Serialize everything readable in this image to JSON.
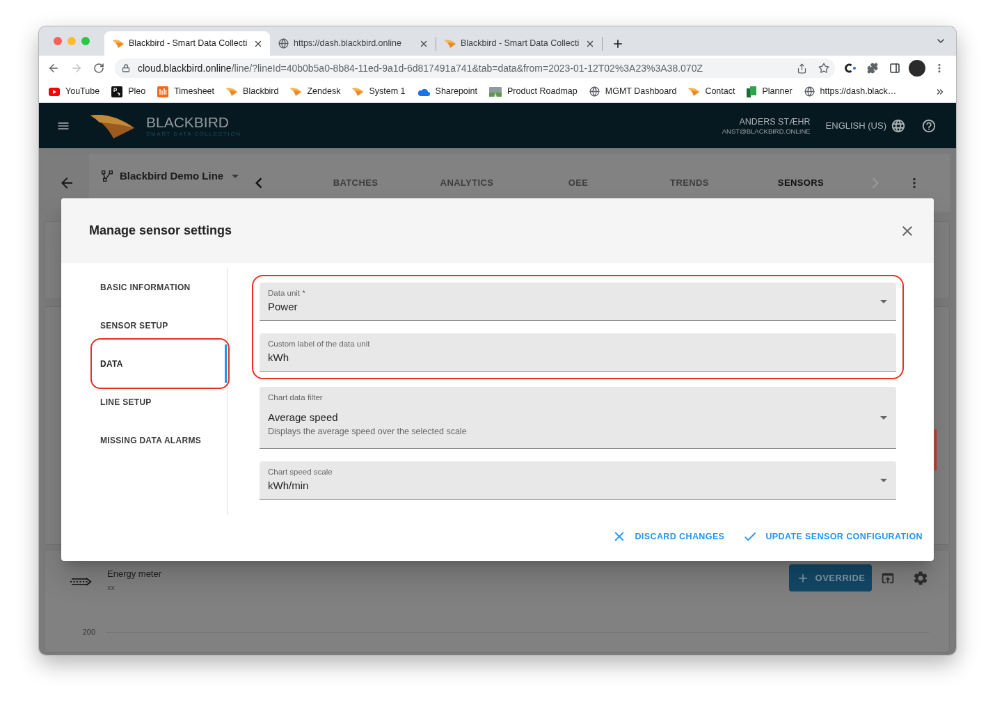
{
  "browser": {
    "tabs": [
      {
        "title": "Blackbird - Smart Data Collecti",
        "kind": "wedge",
        "selected": true
      },
      {
        "title": "https://dash.blackbird.online",
        "kind": "globe",
        "selected": false
      },
      {
        "title": "Blackbird - Smart Data Collecti",
        "kind": "wedge",
        "selected": false
      }
    ],
    "forward_disabled": true,
    "address": {
      "host": "cloud.blackbird.online",
      "path": "/line/?lineId=40b0b5a0-8b84-11ed-9a1d-6d817491a741&tab=data&from=2023-01-12T02%3A23%3A38.070Z"
    },
    "bookmarks": [
      {
        "label": "YouTube",
        "kind": "play"
      },
      {
        "label": "Pleo",
        "kind": "monogram"
      },
      {
        "label": "Timesheet",
        "kind": "bars"
      },
      {
        "label": "Blackbird",
        "kind": "wedge"
      },
      {
        "label": "Zendesk",
        "kind": "wedge"
      },
      {
        "label": "System 1",
        "kind": "wedge"
      },
      {
        "label": "Sharepoint",
        "kind": "cloud"
      },
      {
        "label": "Product Roadmap",
        "kind": "landscape"
      },
      {
        "label": "MGMT Dashboard",
        "kind": "globe"
      },
      {
        "label": "Contact",
        "kind": "wedge"
      },
      {
        "label": "Planner",
        "kind": "sheets"
      },
      {
        "label": "https://dash.black…",
        "kind": "globe"
      }
    ]
  },
  "app_header": {
    "brand": "BLACKBIRD",
    "tagline": "SMART DATA COLLECTION",
    "user_name": "ANDERS STÆHR",
    "user_email": "ANST@BLACKBIRD.ONLINE",
    "language": "ENGLISH (US)"
  },
  "line_bar": {
    "line_name": "Blackbird Demo Line",
    "next_disabled": true,
    "tabs": [
      {
        "label": "BATCHES",
        "selected": false
      },
      {
        "label": "ANALYTICS",
        "selected": false
      },
      {
        "label": "OEE",
        "selected": false
      },
      {
        "label": "TRENDS",
        "selected": false
      },
      {
        "label": "SENSORS",
        "selected": true
      }
    ]
  },
  "dialog": {
    "title": "Manage sensor settings",
    "nav": [
      {
        "label": "BASIC INFORMATION",
        "selected": false,
        "highlighted": false
      },
      {
        "label": "SENSOR SETUP",
        "selected": false,
        "highlighted": false
      },
      {
        "label": "DATA",
        "selected": true,
        "highlighted": true
      },
      {
        "label": "LINE SETUP",
        "selected": false,
        "highlighted": false
      },
      {
        "label": "MISSING DATA ALARMS",
        "selected": false,
        "highlighted": false
      }
    ],
    "fields": [
      {
        "kind": "select",
        "label": "Data unit *",
        "value": "Power",
        "highlighted": true
      },
      {
        "kind": "text",
        "label": "Custom label of the data unit",
        "value": "kWh",
        "highlighted": true
      },
      {
        "kind": "select",
        "label": "Chart data filter",
        "value": "Average speed",
        "helper": "Displays the average speed over the selected scale",
        "highlighted": false
      },
      {
        "kind": "select",
        "label": "Chart speed scale",
        "value": "kWh/min",
        "highlighted": false
      }
    ],
    "actions": [
      {
        "kind": "discard",
        "label": "DISCARD CHANGES"
      },
      {
        "kind": "confirm",
        "label": "UPDATE SENSOR CONFIGURATION"
      }
    ]
  },
  "sensor_card": {
    "name": "Energy meter",
    "subtitle": "xx",
    "override_label": "OVERRIDE",
    "y_tick": "200"
  }
}
